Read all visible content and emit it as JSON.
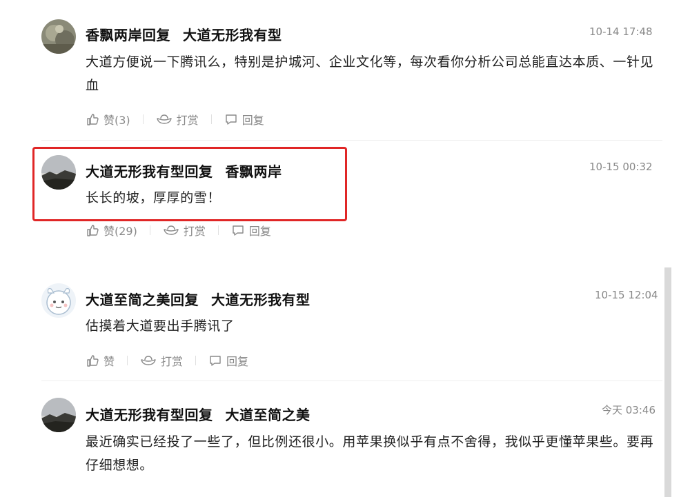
{
  "comments": [
    {
      "author": "香飘两岸",
      "reply_word": "回复",
      "target": "大道无形我有型",
      "time": "10-14 17:48",
      "text": "大道方便说一下腾讯么，特别是护城河、企业文化等，每次看你分析公司总能直达本质、一针见血",
      "like_label": "赞(3)",
      "tip_label": "打赏",
      "reply_label": "回复"
    },
    {
      "author": "大道无形我有型",
      "reply_word": "回复",
      "target": "香飘两岸",
      "time": "10-15 00:32",
      "text": "长长的坡，厚厚的雪！",
      "like_label": "赞(29)",
      "tip_label": "打赏",
      "reply_label": "回复"
    },
    {
      "author": "大道至简之美",
      "reply_word": "回复",
      "target": "大道无形我有型",
      "time": "10-15 12:04",
      "text": "估摸着大道要出手腾讯了",
      "like_label": "赞",
      "tip_label": "打赏",
      "reply_label": "回复"
    },
    {
      "author": "大道无形我有型",
      "reply_word": "回复",
      "target": "大道至简之美",
      "time": "今天 03:46",
      "text": "最近确实已经投了一些了，但比例还很小。用苹果换似乎有点不舍得，我似乎更懂苹果些。要再仔细想想。"
    }
  ],
  "colors": {
    "highlight": "#e02626",
    "meta_gray": "#888888",
    "text_dark": "#222222"
  },
  "icons": {
    "like": "thumbs-up-icon",
    "tip": "ingot-icon",
    "reply": "comment-bubble-icon"
  }
}
